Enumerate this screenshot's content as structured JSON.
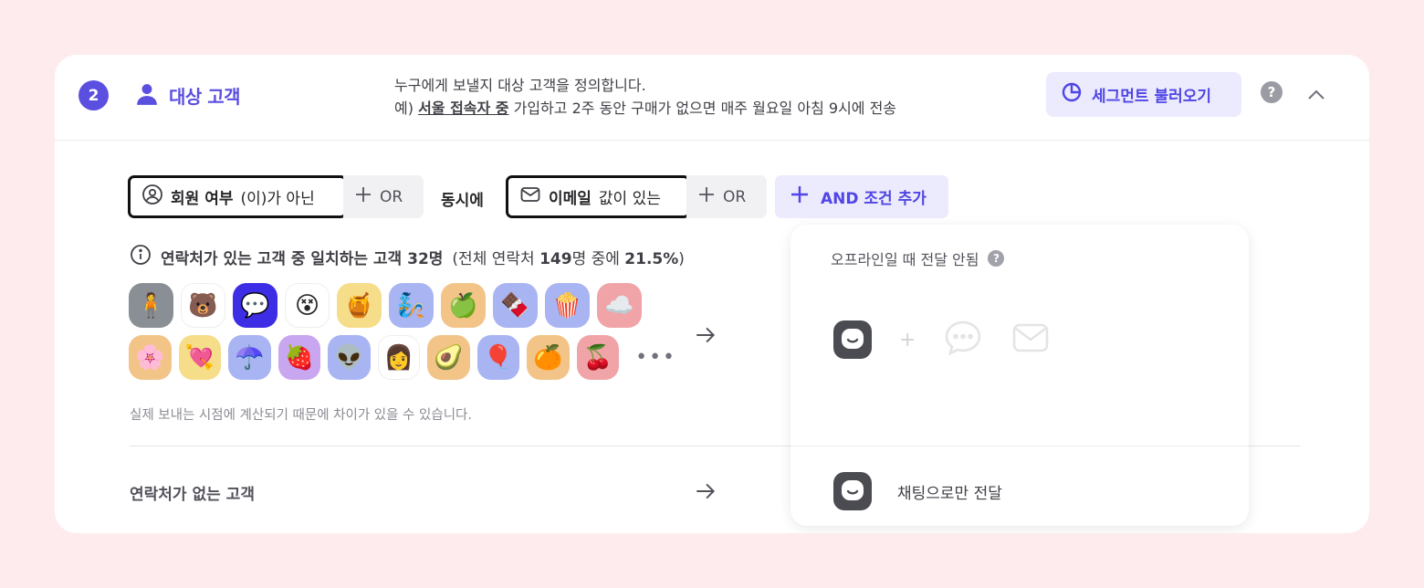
{
  "header": {
    "step_number": "2",
    "title": "대상 고객",
    "desc_line1": "누구에게 보낼지 대상 고객을 정의합니다.",
    "desc_prefix": "예) ",
    "desc_underline": "서울 접속자 중",
    "desc_suffix": " 가입하고 2주 동안 구매가 없으면 매주 월요일 아침 9시에 전송",
    "segment_button": "세그먼트 불러오기",
    "help": "?"
  },
  "conditions": [
    {
      "field": "회원 여부",
      "operator": "(이)가 아닌",
      "or_label": "OR",
      "icon": "user-circle-icon"
    },
    {
      "field": "이메일",
      "operator": "값이 있는",
      "or_label": "OR",
      "icon": "mail-icon"
    }
  ],
  "and_join": "동시에",
  "and_button": "AND 조건 추가",
  "stats": {
    "prefix": "연락처가 있는 고객 중 일치하는 고객 32명",
    "detail_open": "(전체 연락처 ",
    "total": "149",
    "detail_mid": "명 중에 ",
    "percent": "21.5%",
    "detail_close": ")"
  },
  "avatars_row1": [
    {
      "emoji": "🧍",
      "bg": "#8a8f96"
    },
    {
      "emoji": "🐻",
      "bg": "#ffffff"
    },
    {
      "emoji": "💬",
      "bg": "#3d2ee6"
    },
    {
      "emoji": "😵",
      "bg": "#ffffff"
    },
    {
      "emoji": "🍯",
      "bg": "#f6dd8a"
    },
    {
      "emoji": "🧞",
      "bg": "#a9b4f2"
    },
    {
      "emoji": "🍏",
      "bg": "#f3c488"
    },
    {
      "emoji": "🍫",
      "bg": "#a9b4f2"
    },
    {
      "emoji": "🍿",
      "bg": "#a9b4f2"
    },
    {
      "emoji": "☁️",
      "bg": "#f0a4a8"
    }
  ],
  "avatars_row2": [
    {
      "emoji": "🌸",
      "bg": "#f3c488"
    },
    {
      "emoji": "💘",
      "bg": "#f6dd8a"
    },
    {
      "emoji": "☂️",
      "bg": "#a9b4f2"
    },
    {
      "emoji": "🍓",
      "bg": "#c8a6f0"
    },
    {
      "emoji": "👽",
      "bg": "#a9b4f2"
    },
    {
      "emoji": "👩",
      "bg": "#ffffff"
    },
    {
      "emoji": "🥑",
      "bg": "#f3c488"
    },
    {
      "emoji": "🎈",
      "bg": "#a9b4f2"
    },
    {
      "emoji": "🍊",
      "bg": "#f3c488"
    },
    {
      "emoji": "🍒",
      "bg": "#f0a4a8"
    }
  ],
  "more": "•••",
  "note": "실제 보내는 시점에 계산되기 때문에 차이가 있을 수 있습니다.",
  "no_contact_label": "연락처가 없는 고객",
  "panel": {
    "title": "오프라인일 때 전달 안됨",
    "help": "?",
    "plus": "+",
    "footer": "채팅으로만 전달"
  },
  "colors": {
    "accent": "#5b4fe0",
    "accent_bg": "#eceafd",
    "page_bg": "#fdebee"
  }
}
